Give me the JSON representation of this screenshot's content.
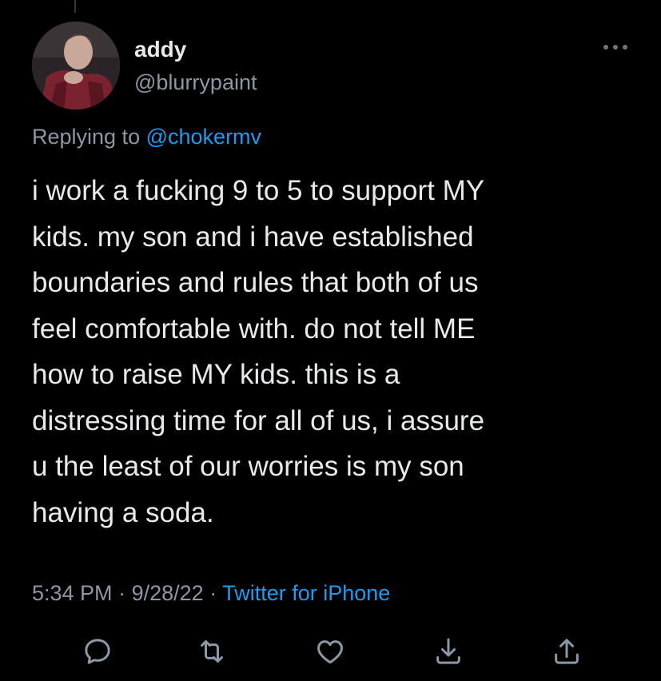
{
  "tweet": {
    "author": {
      "name": "addy",
      "handle": "@blurrypaint"
    },
    "replying_prefix": "Replying to",
    "replying_to": "@chokermv",
    "text": "i work a fucking 9 to 5 to support MY\nkids. my son and i have established\nboundaries and rules that both of us\nfeel comfortable with. do not tell ME\nhow to raise MY kids. this is a\ndistressing time for all of us, i assure\nu the least of our worries is my son\nhaving a soda.",
    "time": "5:34 PM",
    "date": "9/28/22",
    "separator": "·",
    "source": "Twitter for iPhone"
  },
  "actions": [
    {
      "name": "reply",
      "icon": "comment-icon"
    },
    {
      "name": "retweet",
      "icon": "retweet-icon"
    },
    {
      "name": "like",
      "icon": "heart-icon"
    },
    {
      "name": "bookmark",
      "icon": "bookmark-download-icon"
    },
    {
      "name": "share",
      "icon": "share-icon"
    }
  ],
  "colors": {
    "background": "#000000",
    "text": "#e7e9ea",
    "secondary": "#8b98a5",
    "link": "#1d9bf0"
  }
}
